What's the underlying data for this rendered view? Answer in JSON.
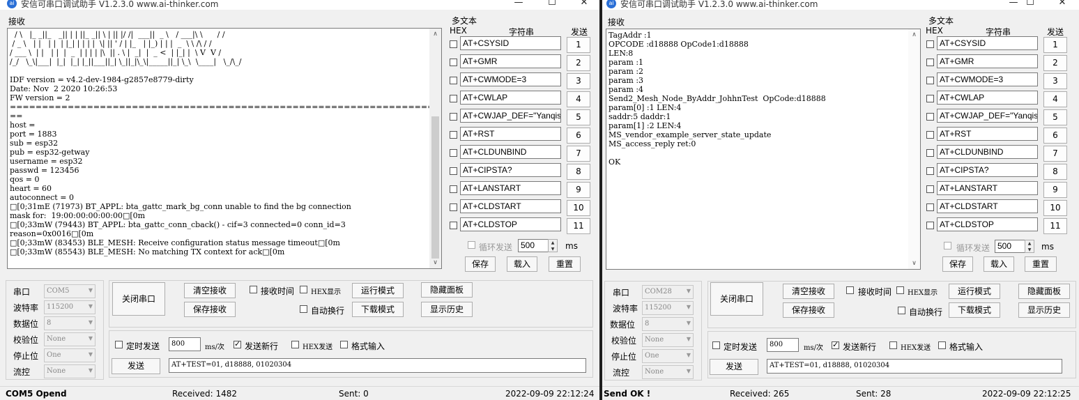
{
  "left": {
    "title": "安信可串口调试助手 V1.2.3.0    www.ai-thinker.com",
    "window_controls": {
      "minimize": "—",
      "maximize": "☐",
      "close": "✕"
    },
    "recv_label": "接收",
    "recv_text": "  / \\   |_ _||_   _|| | | ||_ _|| \\ | || |/ /|  ___||  _ \\   / ___|\\ \\      / /\n / _ \\   | |   | |  | |_| | | | |  \\| || ' / | |_   | |_) | | |  _  \\ \\ /\\ / / \n/ ___ \\  | |   | |  |  _  | | | | |\\  || . \\ |  _|  |  _ <  | |_| |  \\ V  V /  \n/_/   \\_\\|___|  |_|  |_| |_||___||_| \\_||_|\\_\\|_____||_| \\_\\  \\____|   \\_/\\_/   \n\nIDF version = v4.2-dev-1984-g2857e8779-dirty\nDate: Nov  2 2020 10:26:53\nFW version = 2\n=================================================================================\n==\nhost = \nport = 1883\nsub = esp32\npub = esp32-getway\nusername = esp32\npasswd = 123456\nqos = 0\nheart = 60\nautoconnect = 0\n□[0;31mE (71973) BT_APPL: bta_gattc_mark_bg_conn unable to find the bg connection\nmask for:  19:00:00:00:00:00□[0m\n□[0;33mW (79443) BT_APPL: bta_gattc_conn_cback() - cif=3 connected=0 conn_id=3\nreason=0x0016□[0m\n□[0;33mW (83453) BLE_MESH: Receive configuration status message timeout□[0m\n□[0;33mW (85543) BLE_MESH: No matching TX context for ack□[0m",
    "multi": {
      "title": "多文本",
      "hex": "HEX",
      "string": "字符串",
      "send": "发送",
      "items": [
        {
          "cmd": "AT+CSYSID",
          "n": "1"
        },
        {
          "cmd": "AT+GMR",
          "n": "2"
        },
        {
          "cmd": "AT+CWMODE=3",
          "n": "3"
        },
        {
          "cmd": "AT+CWLAP",
          "n": "4"
        },
        {
          "cmd": "AT+CWJAP_DEF=\"Yanqisu",
          "n": "5"
        },
        {
          "cmd": "AT+RST",
          "n": "6"
        },
        {
          "cmd": "AT+CLDUNBIND",
          "n": "7"
        },
        {
          "cmd": "AT+CIPSTA?",
          "n": "8"
        },
        {
          "cmd": "AT+LANSTART",
          "n": "9"
        },
        {
          "cmd": "AT+CLDSTART",
          "n": "10"
        },
        {
          "cmd": "AT+CLDSTOP",
          "n": "11"
        }
      ],
      "loop_send": "循环发送",
      "interval": "500",
      "ms": "ms",
      "save": "保存",
      "load": "载入",
      "reset": "重置"
    },
    "port": {
      "port_label": "串口",
      "port_value": "COM5",
      "baud_label": "波特率",
      "baud_value": "115200",
      "data_label": "数据位",
      "data_value": "8",
      "parity_label": "校验位",
      "parity_value": "None",
      "stop_label": "停止位",
      "stop_value": "One",
      "flow_label": "流控",
      "flow_value": "None"
    },
    "ctrl": {
      "close_port": "关闭串口",
      "clear_recv": "清空接收",
      "save_recv": "保存接收",
      "recv_time": "接收时间",
      "hex_show": "HEX显示",
      "run_mode": "运行模式",
      "hide_panel": "隐藏面板",
      "auto_wrap": "自动换行",
      "download_mode": "下载模式",
      "show_history": "显示历史",
      "timed_send": "定时发送",
      "period": "800",
      "period_unit": "ms/次",
      "send_newline": "发送新行",
      "hex_send": "HEX发送",
      "format_input": "格式输入",
      "send": "发送",
      "send_text": "AT+TEST=01, d18888, 01020304"
    },
    "status": {
      "state": "COM5 Opend",
      "received": "Received: 1482",
      "sent": "Sent: 0",
      "time": "2022-09-09 22:12:24"
    }
  },
  "right": {
    "title": "安信可串口调试助手 V1.2.3.0    www.ai-thinker.com",
    "window_controls": {
      "minimize": "—",
      "maximize": "☐",
      "close": "✕"
    },
    "recv_label": "接收",
    "recv_text": "TagAddr :1\nOPCODE :d18888 OpCode1:d18888\nLEN:8\nparam :1\nparam :2\nparam :3\nparam :4\nSend2_Mesh_Node_ByAddr_JohhnTest  OpCode:d18888\nparam[0] :1 LEN:4\nsaddr:5 daddr:1\nparam[1] :2 LEN:4\nMS_vendor_example_server_state_update\nMS_access_reply ret:0\n\nOK",
    "multi": {
      "title": "多文本",
      "hex": "HEX",
      "string": "字符串",
      "send": "发送",
      "items": [
        {
          "cmd": "AT+CSYSID",
          "n": "1"
        },
        {
          "cmd": "AT+GMR",
          "n": "2"
        },
        {
          "cmd": "AT+CWMODE=3",
          "n": "3"
        },
        {
          "cmd": "AT+CWLAP",
          "n": "4"
        },
        {
          "cmd": "AT+CWJAP_DEF=\"Yanqisu",
          "n": "5"
        },
        {
          "cmd": "AT+RST",
          "n": "6"
        },
        {
          "cmd": "AT+CLDUNBIND",
          "n": "7"
        },
        {
          "cmd": "AT+CIPSTA?",
          "n": "8"
        },
        {
          "cmd": "AT+LANSTART",
          "n": "9"
        },
        {
          "cmd": "AT+CLDSTART",
          "n": "10"
        },
        {
          "cmd": "AT+CLDSTOP",
          "n": "11"
        }
      ],
      "loop_send": "循环发送",
      "interval": "500",
      "ms": "ms",
      "save": "保存",
      "load": "载入",
      "reset": "重置"
    },
    "port": {
      "port_label": "串口",
      "port_value": "COM28",
      "baud_label": "波特率",
      "baud_value": "115200",
      "data_label": "数据位",
      "data_value": "8",
      "parity_label": "校验位",
      "parity_value": "None",
      "stop_label": "停止位",
      "stop_value": "One",
      "flow_label": "流控",
      "flow_value": "None"
    },
    "ctrl": {
      "close_port": "关闭串口",
      "clear_recv": "清空接收",
      "save_recv": "保存接收",
      "recv_time": "接收时间",
      "hex_show": "HEX显示",
      "run_mode": "运行模式",
      "hide_panel": "隐藏面板",
      "auto_wrap": "自动换行",
      "download_mode": "下载模式",
      "show_history": "显示历史",
      "timed_send": "定时发送",
      "period": "800",
      "period_unit": "ms/次",
      "send_newline": "发送新行",
      "hex_send": "HEX发送",
      "format_input": "格式输入",
      "send": "发送",
      "send_text": "AT+TEST=01, d18888, 01020304"
    },
    "status": {
      "state": "Send OK !",
      "received": "Received: 265",
      "sent": "Sent: 28",
      "time": "2022-09-09 22:12:25"
    }
  },
  "colors": {
    "window_bg": "#f0f0f0",
    "text_bg": "#ffffff",
    "app_icon": "#2a6fd6"
  }
}
